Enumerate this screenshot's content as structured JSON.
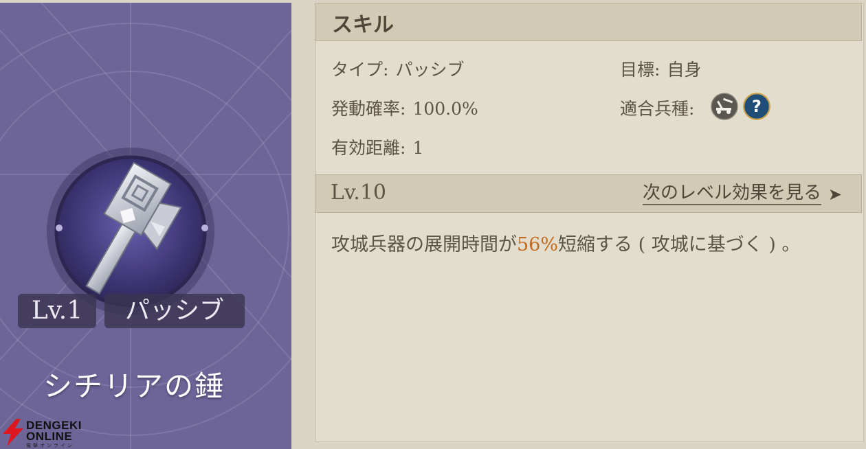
{
  "card": {
    "level_tag": "Lv.1",
    "type_tag": "パッシブ",
    "skill_name": "シチリアの錘"
  },
  "watermark": {
    "line1": "DENGEKI",
    "line2": "ONLINE",
    "line3": "電撃オンライン"
  },
  "panel": {
    "header_title": "スキル",
    "type_label": "タイプ:",
    "type_value": "パッシブ",
    "target_label": "目標:",
    "target_value": "自身",
    "activation_label": "発動確率:",
    "activation_value": "100.0%",
    "troop_label": "適合兵種:",
    "troop_icons": [
      "siege-unit-icon",
      "question-icon"
    ],
    "range_label": "有効距離:",
    "range_value": "1",
    "level_label": "Lv.10",
    "next_level_link": "次のレベル効果を見る",
    "next_arrow": "➤",
    "effect_prefix": "攻城兵器の展開時間が",
    "effect_highlight": "56%",
    "effect_suffix": "短縮する ( 攻城に基づく ) 。"
  },
  "colors": {
    "card_bg": "#6d6498",
    "panel_bg": "#e2ddcd",
    "bar_bg": "#d2cab4",
    "highlight": "#c46a1e"
  }
}
